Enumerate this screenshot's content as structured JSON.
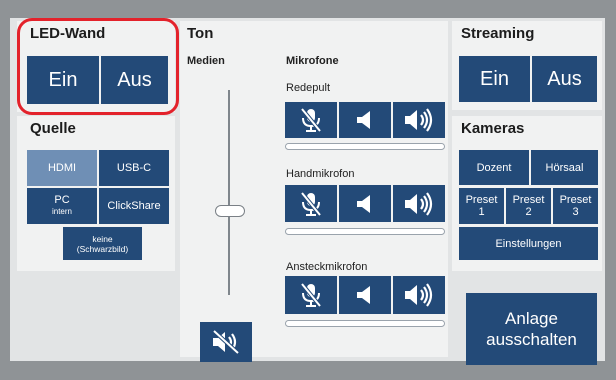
{
  "led": {
    "title": "LED-Wand",
    "on_label": "Ein",
    "off_label": "Aus"
  },
  "source": {
    "title": "Quelle",
    "hdmi": "HDMI",
    "usbc": "USB-C",
    "pc": "PC",
    "pc_sub": "intern",
    "clickshare": "ClickShare",
    "none_line1": "keine",
    "none_line2": "(Schwarzbild)",
    "selected": "HDMI"
  },
  "audio": {
    "title": "Ton",
    "media_label": "Medien",
    "mics_label": "Mikrofone",
    "mics": [
      {
        "name": "Redepult"
      },
      {
        "name": "Handmikrofon"
      },
      {
        "name": "Ansteckmikrofon"
      }
    ]
  },
  "streaming": {
    "title": "Streaming",
    "on_label": "Ein",
    "off_label": "Aus"
  },
  "cameras": {
    "title": "Kameras",
    "dozent": "Dozent",
    "hoersaal": "Hörsaal",
    "preset_label": "Preset",
    "preset1": "1",
    "preset2": "2",
    "preset3": "3",
    "settings": "Einstellungen"
  },
  "system": {
    "shutdown_line1": "Anlage",
    "shutdown_line2": "ausschalten"
  },
  "colors": {
    "button": "#234a78",
    "button_selected": "#6f8fb5",
    "highlight": "#e3222b"
  },
  "icons": [
    "mute-mic-icon",
    "speaker-icon",
    "speaker-volume-icon",
    "speaker-mute-icon"
  ]
}
